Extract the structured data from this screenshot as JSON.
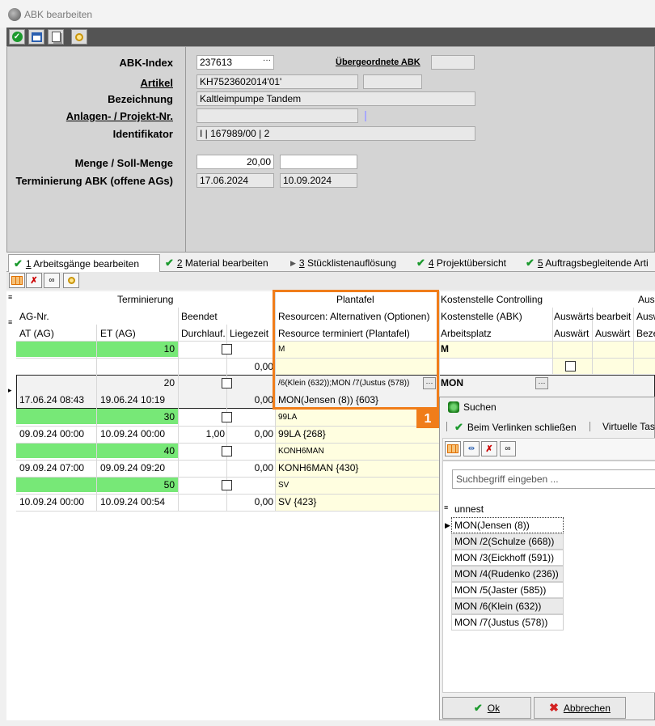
{
  "window": {
    "title": "ABK bearbeiten"
  },
  "header": {
    "labels": {
      "abk_index": "ABK-Index",
      "artikel": "Artikel",
      "bezeichnung": "Bezeichnung",
      "anlagen": "Anlagen- / Projekt-Nr.",
      "identifikator": "Identifikator",
      "menge": "Menge / Soll-Menge",
      "terminierung": "Terminierung ABK (offene AGs)",
      "uebergeordnete": "Übergeordnete ABK"
    },
    "values": {
      "abk_index": "237613",
      "abk_index_btn": "···",
      "artikel": "KH7523602014'01'",
      "bezeichnung": "Kaltleimpumpe Tandem",
      "anlagen": "",
      "identifikator": "I | 167989/00 | 2",
      "menge": "20,00",
      "soll_menge": "",
      "termin_start": "17.06.2024",
      "termin_end": "10.09.2024"
    }
  },
  "tabs": [
    {
      "num": "1",
      "label": " Arbeitsgänge bearbeiten"
    },
    {
      "num": "2",
      "label": " Material bearbeiten"
    },
    {
      "num": "3",
      "label": " Stücklistenauflösung"
    },
    {
      "num": "4",
      "label": " Projektübersicht"
    },
    {
      "num": "5",
      "label": " Auftragsbegleitende Arti"
    }
  ],
  "grid": {
    "headers": {
      "terminierung": "Terminierung",
      "ag_nr": "AG-Nr.",
      "at_ag": "AT (AG)",
      "et_ag": "ET (AG)",
      "beendet": "Beendet",
      "durchlauf": "Durchlauf.",
      "liegezeit": "Liegezeit",
      "plantafel": "Plantafel",
      "resourcen_alt": "Resourcen: Alternativen (Optionen)",
      "resource_term": "Resource terminiert (Plantafel)",
      "kst_controlling": "Kostenstelle Controlling",
      "kst_abk": "Kostenstelle (ABK)",
      "arbeitsplatz": "Arbeitsplatz",
      "auswerts": "Auswärts",
      "bearbeit": "bearbeit",
      "ausw2": "Ausw",
      "auswaert": "Auswärt",
      "auswaert2": "Auswärt",
      "beze": "Beze",
      "aus_top": "Aus"
    },
    "first_row": {
      "ag": "10",
      "res": "M",
      "kst": "M",
      "liegezeit": "0,00"
    },
    "rows": [
      {
        "ag": "20",
        "at": "17.06.24 08:43",
        "et": "19.06.24 10:19",
        "durchlauf": "",
        "liegezeit": "0,00",
        "res_alt": "/6(Klein  (632));MON /7(Justus (578))",
        "res_term": "MON(Jensen  (8)) {603}",
        "kst": "MON",
        "btn": "···"
      },
      {
        "ag": "30",
        "at": "09.09.24 00:00",
        "et": "10.09.24 00:00",
        "durchlauf": "1,00",
        "liegezeit": "0,00",
        "res_alt": "99LA",
        "res_term": "99LA {268}"
      },
      {
        "ag": "40",
        "at": "09.09.24 07:00",
        "et": "09.09.24 09:20",
        "durchlauf": "",
        "liegezeit": "0,00",
        "res_alt": "KONH6MAN",
        "res_term": "KONH6MAN {430}"
      },
      {
        "ag": "50",
        "at": "10.09.24 00:00",
        "et": "10.09.24 00:54",
        "durchlauf": "",
        "liegezeit": "0,00",
        "res_alt": "SV",
        "res_term": "SV {423}"
      }
    ]
  },
  "badge": "1",
  "search_dialog": {
    "title": "Suchen",
    "link_close": "Beim Verlinken schließen",
    "virtual": "Virtuelle Tast",
    "placeholder": "Suchbegriff eingeben ...",
    "tree_root": "unnest",
    "items": [
      "MON(Jensen  (8))",
      "MON /2(Schulze  (668))",
      "MON /3(Eickhoff  (591))",
      "MON /4(Rudenko  (236))",
      "MON /5(Jaster (585))",
      "MON /6(Klein  (632))",
      "MON /7(Justus (578))"
    ],
    "ok": "Ok",
    "cancel": "Abbrechen"
  },
  "colors": {
    "accent": "#f07d1a",
    "green": "#77e877",
    "toolbar": "#545454"
  }
}
